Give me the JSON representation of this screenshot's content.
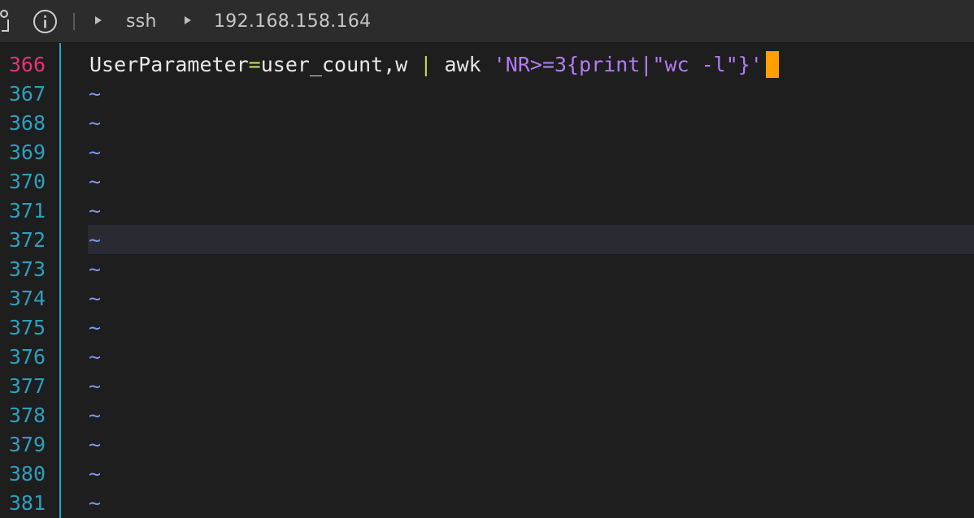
{
  "breadcrumb": {
    "items": [
      "ssh",
      "192.168.158.164"
    ]
  },
  "editor": {
    "current_line": "366",
    "cursor_line_highlight": "372",
    "code_line": {
      "key": "UserParameter",
      "eq": "=",
      "value": "user_count,w ",
      "pipe": "|",
      "cmd": " awk ",
      "awk_string": "'NR>=3{print|\"wc -l\"}'"
    },
    "lines": [
      {
        "num": "366",
        "text": ""
      },
      {
        "num": "367",
        "text": "~"
      },
      {
        "num": "368",
        "text": "~"
      },
      {
        "num": "369",
        "text": "~"
      },
      {
        "num": "370",
        "text": "~"
      },
      {
        "num": "371",
        "text": "~"
      },
      {
        "num": "372",
        "text": "~"
      },
      {
        "num": "373",
        "text": "~"
      },
      {
        "num": "374",
        "text": "~"
      },
      {
        "num": "375",
        "text": "~"
      },
      {
        "num": "376",
        "text": "~"
      },
      {
        "num": "377",
        "text": "~"
      },
      {
        "num": "378",
        "text": "~"
      },
      {
        "num": "379",
        "text": "~"
      },
      {
        "num": "380",
        "text": "~"
      },
      {
        "num": "381",
        "text": "~"
      }
    ]
  },
  "colors": {
    "line_number": "#2f9fbd",
    "current_line_number": "#e2347a",
    "tilde": "#8297f0",
    "string": "#b27cf3",
    "operator": "#b6e35a",
    "cursor": "#ffa000"
  },
  "icons": [
    "info-icon",
    "chevron-right-icon"
  ]
}
